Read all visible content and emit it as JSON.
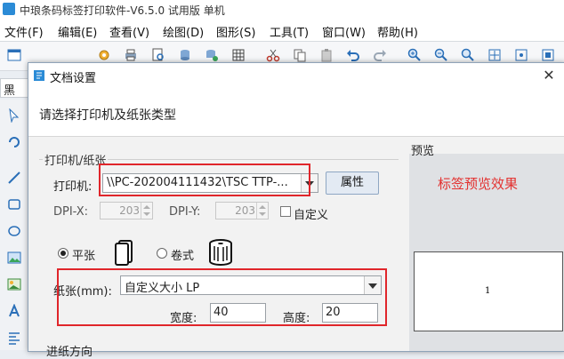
{
  "app": {
    "title": "中琅条码标签打印软件-V6.5.0 试用版 单机"
  },
  "menu": [
    "文件(F)",
    "编辑(E)",
    "查看(V)",
    "绘图(D)",
    "图形(S)",
    "工具(T)",
    "窗口(W)",
    "帮助(H)"
  ],
  "font_box": "黑体",
  "dialog": {
    "title": "文档设置",
    "close": "✕",
    "instruction": "请选择打印机及纸张类型",
    "printer_group_label": "打印机/纸张",
    "printer_label": "打印机:",
    "printer_value": "\\\\PC-202004111432\\TSC TTP-...",
    "properties_button": "属性",
    "dpi_x_label": "DPI-X:",
    "dpi_x_value": "203",
    "dpi_y_label": "DPI-Y:",
    "dpi_y_value": "203",
    "custom_label": "自定义",
    "sheet_label": "平张",
    "roll_label": "卷式",
    "paper_label": "纸张(mm):",
    "paper_value": "自定义大小 LP",
    "width_label": "宽度:",
    "width_value": "40",
    "height_label": "高度:",
    "height_value": "20",
    "feed_direction_label": "进纸方向",
    "preview_label": "预览",
    "preview_effect": "标签预览效果",
    "preview_number": "1"
  },
  "colors": {
    "annotation_red": "#e0262b",
    "preview_text_red": "#e3312f"
  }
}
